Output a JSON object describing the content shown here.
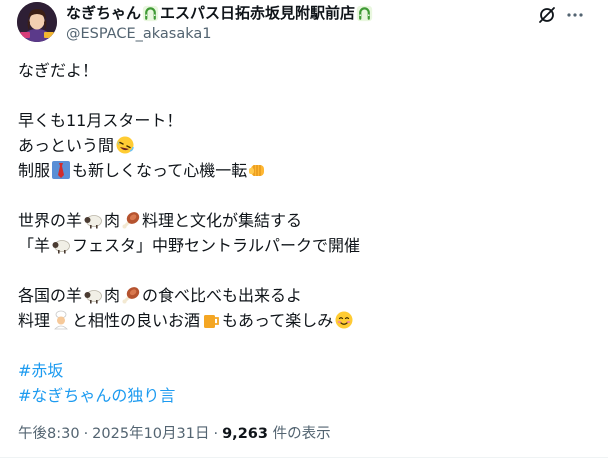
{
  "author": {
    "display_name": "なぎちゃん",
    "display_name_suffix": "エスパス日拓赤坂見附駅前店",
    "handle": "@ESPACE_akasaka1",
    "name_emoji_1": "horseshoe-emoji",
    "name_emoji_2": "horseshoe-emoji"
  },
  "header_icons": {
    "grok": "grok-icon",
    "more": "more-dots-icon"
  },
  "text": {
    "l1": "なぎだよ！",
    "l2": "早くも11月スタート！",
    "l3": "あっという間",
    "l4a": "制服",
    "l4b": "も新しくなって心機一転",
    "l5a": "世界の羊",
    "l5b": "肉",
    "l5c": "料理と文化が集結する",
    "l6a": "「羊",
    "l6b": "フェスタ」中野セントラルパークで開催",
    "l7a": "各国の羊",
    "l7b": "肉",
    "l7c": "の食べ比べも出来るよ",
    "l8a": "料理",
    "l8b": "と相性の良いお酒",
    "l8c": "もあって楽しみ",
    "hashtag_1": "#赤坂",
    "hashtag_2": "#なぎちゃんの独り言"
  },
  "emojis": {
    "rofl": "rolling-on-floor-laughing-emoji",
    "necktie": "necktie-emoji",
    "fist": "oncoming-fist-emoji",
    "sheep": "sheep-emoji",
    "meat": "meat-on-bone-emoji",
    "cook": "cook-emoji",
    "beer": "beer-mug-emoji",
    "smiling": "smiling-face-emoji"
  },
  "meta": {
    "time": "午後8:30",
    "separator": "·",
    "date": "2025年10月31日",
    "views_count": "9,263",
    "views_label": "件の表示"
  },
  "colors": {
    "accent": "#1d9bf0",
    "text": "#0f1419",
    "secondary": "#536471"
  }
}
